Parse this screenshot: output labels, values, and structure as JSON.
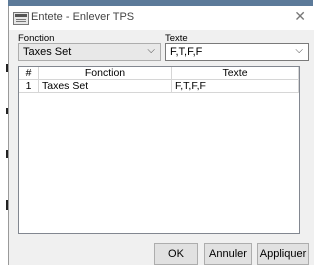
{
  "window": {
    "title": "Entete - Enlever TPS"
  },
  "fonction": {
    "label": "Fonction",
    "value": "Taxes Set"
  },
  "texte": {
    "label": "Texte",
    "value": "F,T,F,F"
  },
  "table": {
    "headers": [
      "#",
      "Fonction",
      "Texte"
    ],
    "rows": [
      {
        "num": "1",
        "fonction": "Taxes Set",
        "texte": "F,T,F,F"
      }
    ]
  },
  "buttons": {
    "ok": "OK",
    "cancel": "Annuler",
    "apply": "Appliquer"
  },
  "icons": {
    "close": "close-icon",
    "app": "app-icon",
    "dropdown": "chevron-down-icon"
  }
}
